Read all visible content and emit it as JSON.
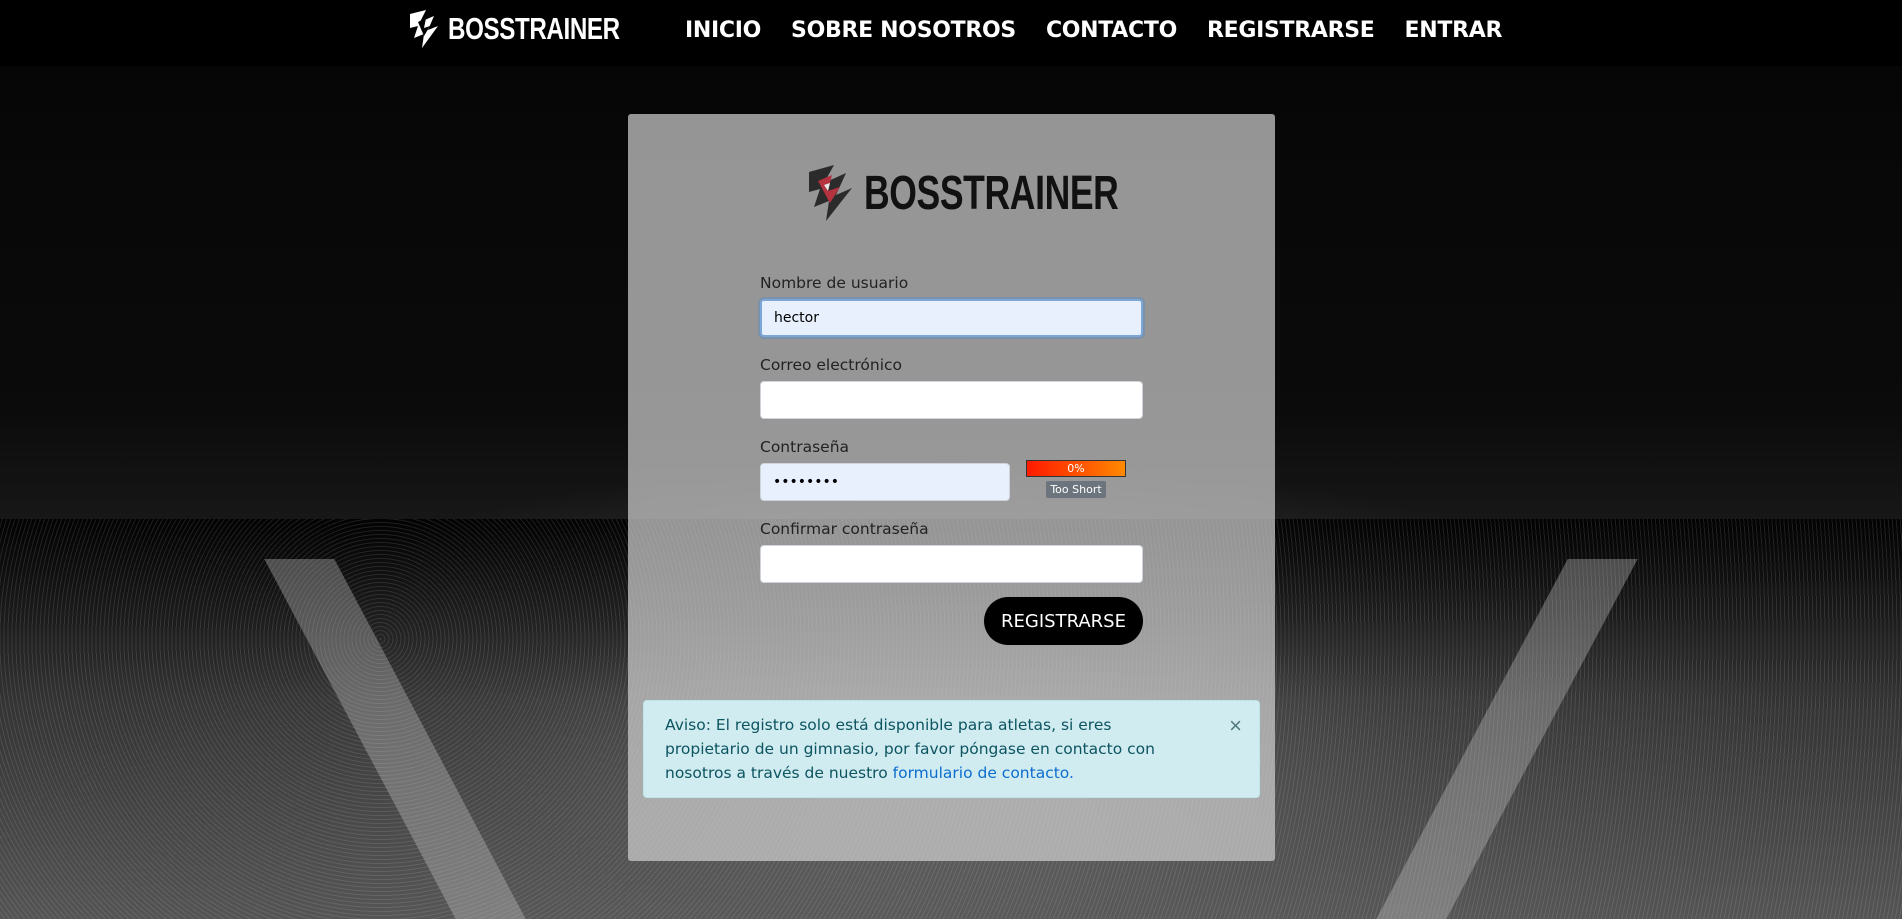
{
  "nav": {
    "brand": "BOSSTRAINER",
    "links": [
      "INICIO",
      "SOBRE NOSOTROS",
      "CONTACTO",
      "REGISTRARSE",
      "ENTRAR"
    ]
  },
  "card": {
    "logo": "BOSSTRAINER",
    "username": {
      "label": "Nombre de usuario",
      "value": "hector"
    },
    "email": {
      "label": "Correo electrónico",
      "value": ""
    },
    "password": {
      "label": "Contraseña",
      "value": "12345678",
      "strength_percent": "0%",
      "strength_text": "Too Short"
    },
    "confirm": {
      "label": "Confirmar contraseña",
      "value": ""
    },
    "submit_label": "REGISTRARSE"
  },
  "alert": {
    "text": "Aviso: El registro solo está disponible para atletas, si eres propietario de un gimnasio, por favor póngase en contacto con nosotros a través de nuestro ",
    "link_text": "formulario de contacto.",
    "close": "×"
  },
  "colors": {
    "nav_bg": "#000000",
    "button_bg": "#000000",
    "alert_bg": "#d1ecf1",
    "logo_accent": "#b5323f"
  },
  "icons": {
    "brand_mark": "bosstrainer-logo-icon",
    "close": "close-icon"
  }
}
